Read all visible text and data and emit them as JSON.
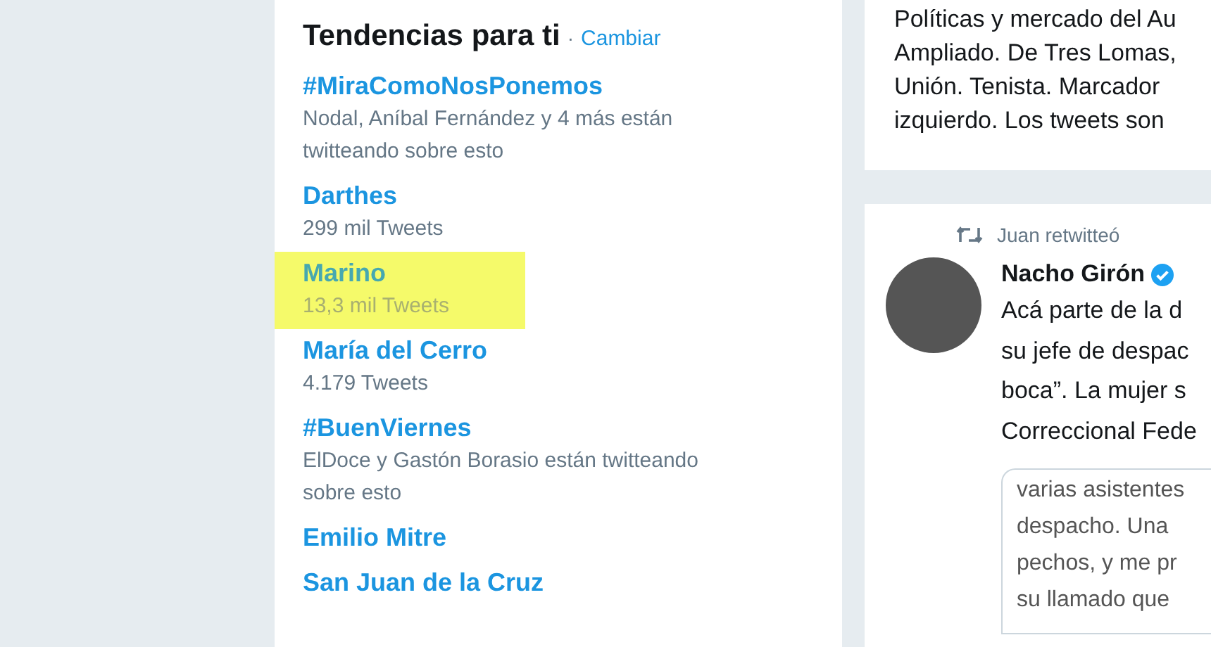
{
  "trends_card": {
    "title": "Tendencias para ti",
    "separator": "·",
    "change_link": "Cambiar",
    "trends": [
      {
        "name": "#MiraComoNosPonemos",
        "subtitle": "Nodal, Aníbal Fernández y 4 más están twitteando sobre esto",
        "highlighted": false
      },
      {
        "name": "Darthes",
        "subtitle": "299 mil Tweets",
        "highlighted": false
      },
      {
        "name": "Marino",
        "subtitle": "13,3 mil Tweets",
        "highlighted": true
      },
      {
        "name": "María del Cerro",
        "subtitle": "4.179 Tweets",
        "highlighted": false
      },
      {
        "name": "#BuenViernes",
        "subtitle": "ElDoce y Gastón Borasio están twitteando sobre esto",
        "highlighted": false
      },
      {
        "name": "Emilio Mitre",
        "highlighted": false
      },
      {
        "name": "San Juan de la Cruz",
        "highlighted": false
      }
    ]
  },
  "bio_card": {
    "lines": [
      "Políticas y mercado del Au",
      "Ampliado. De Tres Lomas,",
      "Unión. Tenista. Marcador",
      "izquierdo. Los tweets son"
    ]
  },
  "tweet": {
    "retweeted_by": "Juan retwitteó",
    "author": "Nacho Girón",
    "verified": true,
    "text_lines": [
      "Acá parte de la d",
      "su jefe de despac",
      "boca”. La mujer s",
      "Correccional Fede"
    ],
    "quote_lines": [
      "varias asistentes",
      "despacho. Una",
      "pechos, y me pr",
      "su llamado que"
    ]
  }
}
